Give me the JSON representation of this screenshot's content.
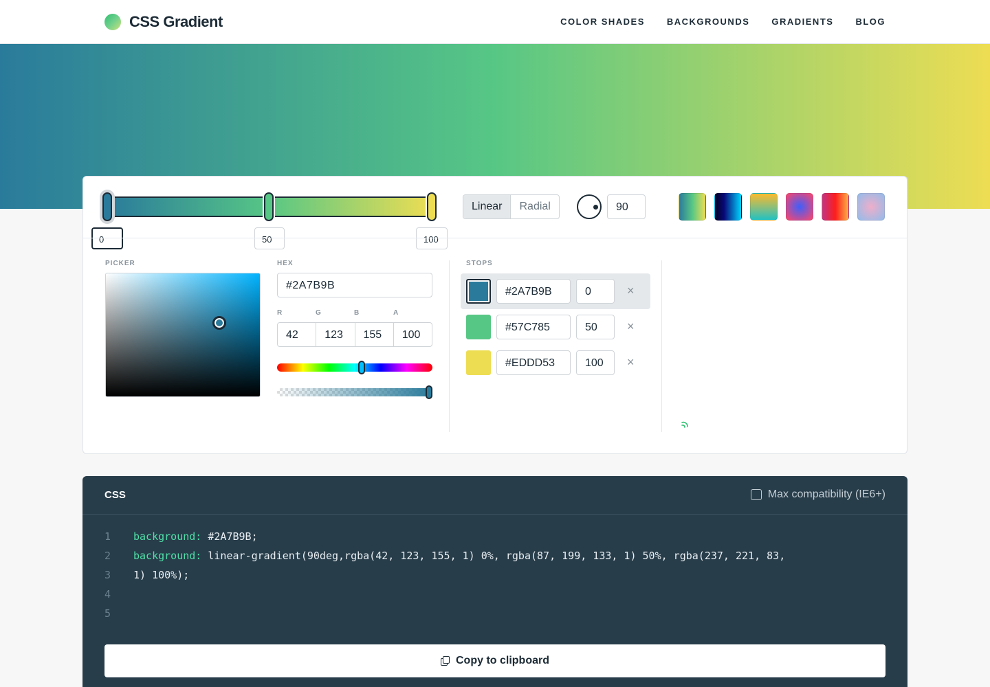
{
  "header": {
    "logo_text": "CSS Gradient",
    "nav": [
      "COLOR SHADES",
      "BACKGROUNDS",
      "GRADIENTS",
      "BLOG"
    ]
  },
  "editor": {
    "stop_labels": [
      "0",
      "50",
      "100"
    ],
    "type_options": [
      "Linear",
      "Radial"
    ],
    "selected_type": "Linear",
    "angle": "90",
    "preset_icons": [
      "preset-teal-yellow",
      "preset-navy-blue",
      "preset-orange-teal",
      "preset-violet-pink",
      "preset-red-orange",
      "preset-pastel"
    ],
    "labels": {
      "picker": "PICKER",
      "hex": "HEX",
      "r": "R",
      "g": "G",
      "b": "B",
      "a": "A",
      "stops": "STOPS"
    },
    "hex_value": "#2A7B9B",
    "rgba": {
      "r": "42",
      "g": "123",
      "b": "155",
      "a": "100"
    },
    "stops": [
      {
        "color": "#2A7B9B",
        "hex": "#2A7B9B",
        "pos": "0",
        "remove": "×"
      },
      {
        "color": "#57C785",
        "hex": "#57C785",
        "pos": "50",
        "remove": "×"
      },
      {
        "color": "#EDDD53",
        "hex": "#EDDD53",
        "pos": "100",
        "remove": "×"
      }
    ]
  },
  "css_panel": {
    "title": "CSS",
    "compat_label": "Max compatibility (IE6+)",
    "line_numbers": [
      "1",
      "2",
      "3",
      "4",
      "5"
    ],
    "line1_prop": "background:",
    "line1_val": " #2A7B9B;",
    "line2_prop": "background:",
    "line2_val": " linear-gradient(90deg,rgba(42, 123, 155, 1) 0%, rgba(87, 199, 133, 1) 50%, rgba(237, 221, 83,",
    "line3_val": "1) 100%);",
    "copy_label": "Copy to clipboard"
  },
  "colors": {
    "stop1": "#2A7B9B",
    "stop2": "#57C785",
    "stop3": "#EDDD53",
    "code_bg": "#283d4a",
    "code_prop": "#4fe0a8"
  }
}
